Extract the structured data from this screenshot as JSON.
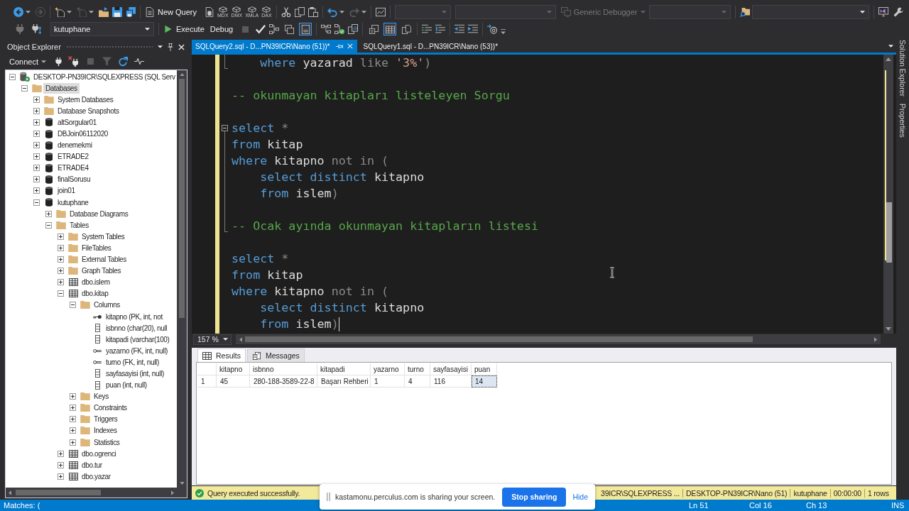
{
  "toolbar": {
    "new_query": "New Query",
    "analysis_queries": [
      "MDX",
      "DMX",
      "XMLA",
      "DAX"
    ],
    "debugger": {
      "label": "Generic Debugger",
      "disabled": true
    },
    "database": "kutuphane",
    "execute": "Execute",
    "debug": "Debug",
    "display_toggles": [
      {
        "on": false
      },
      {
        "on": true
      }
    ],
    "results_toggles": [
      {
        "on": false
      },
      {
        "on": true
      },
      {
        "on": false
      }
    ]
  },
  "object_explorer": {
    "title": "Object Explorer",
    "connect": "Connect",
    "tree": [
      {
        "label": "DESKTOP-PN39ICR\\SQLEXPRESS (SQL Serv",
        "kind": "server",
        "expanded": true,
        "selected": false,
        "children": [
          {
            "label": "Databases",
            "kind": "folder",
            "expanded": true,
            "selected": true,
            "children": [
              {
                "label": "System Databases",
                "kind": "folder",
                "expanded": false,
                "selected": false
              },
              {
                "label": "Database Snapshots",
                "kind": "folder",
                "expanded": false,
                "selected": false
              },
              {
                "label": "altSorgular01",
                "kind": "database",
                "expanded": false,
                "selected": false
              },
              {
                "label": "DBJoin06112020",
                "kind": "database",
                "expanded": false,
                "selected": false
              },
              {
                "label": "denemekmi",
                "kind": "database",
                "expanded": false,
                "selected": false
              },
              {
                "label": "ETRADE2",
                "kind": "database",
                "expanded": false,
                "selected": false
              },
              {
                "label": "ETRADE4",
                "kind": "database",
                "expanded": false,
                "selected": false
              },
              {
                "label": "finalSorusu",
                "kind": "database",
                "expanded": false,
                "selected": false
              },
              {
                "label": "join01",
                "kind": "database",
                "expanded": false,
                "selected": false
              },
              {
                "label": "kutuphane",
                "kind": "database",
                "expanded": true,
                "selected": false,
                "children": [
                  {
                    "label": "Database Diagrams",
                    "kind": "folder",
                    "expanded": false,
                    "selected": false
                  },
                  {
                    "label": "Tables",
                    "kind": "folder",
                    "expanded": true,
                    "selected": false,
                    "children": [
                      {
                        "label": "System Tables",
                        "kind": "folder",
                        "expanded": false,
                        "selected": false
                      },
                      {
                        "label": "FileTables",
                        "kind": "folder",
                        "expanded": false,
                        "selected": false
                      },
                      {
                        "label": "External Tables",
                        "kind": "folder",
                        "expanded": false,
                        "selected": false
                      },
                      {
                        "label": "Graph Tables",
                        "kind": "folder",
                        "expanded": false,
                        "selected": false
                      },
                      {
                        "label": "dbo.islem",
                        "kind": "table",
                        "expanded": false,
                        "selected": false
                      },
                      {
                        "label": "dbo.kitap",
                        "kind": "table",
                        "expanded": true,
                        "selected": false,
                        "children": [
                          {
                            "label": "Columns",
                            "kind": "folder",
                            "expanded": true,
                            "selected": false,
                            "children": [
                              {
                                "label": "kitapno (PK, int, not",
                                "kind": "primary_key",
                                "selected": false
                              },
                              {
                                "label": "isbnno (char(20), null",
                                "kind": "column",
                                "selected": false
                              },
                              {
                                "label": "kitapadi (varchar(100)",
                                "kind": "column",
                                "selected": false
                              },
                              {
                                "label": "yazarno (FK, int, null)",
                                "kind": "foreign_key",
                                "selected": false
                              },
                              {
                                "label": "turno (FK, int, null)",
                                "kind": "foreign_key",
                                "selected": false
                              },
                              {
                                "label": "sayfasayisi (int, null)",
                                "kind": "column",
                                "selected": false
                              },
                              {
                                "label": "puan (int, null)",
                                "kind": "column",
                                "selected": false
                              }
                            ]
                          },
                          {
                            "label": "Keys",
                            "kind": "folder",
                            "expanded": false,
                            "selected": false
                          },
                          {
                            "label": "Constraints",
                            "kind": "folder",
                            "expanded": false,
                            "selected": false
                          },
                          {
                            "label": "Triggers",
                            "kind": "folder",
                            "expanded": false,
                            "selected": false
                          },
                          {
                            "label": "Indexes",
                            "kind": "folder",
                            "expanded": false,
                            "selected": false
                          },
                          {
                            "label": "Statistics",
                            "kind": "folder",
                            "expanded": false,
                            "selected": false
                          }
                        ]
                      },
                      {
                        "label": "dbo.ogrenci",
                        "kind": "table",
                        "expanded": false,
                        "selected": false
                      },
                      {
                        "label": "dbo.tur",
                        "kind": "table",
                        "expanded": false,
                        "selected": false
                      },
                      {
                        "label": "dbo.yazar",
                        "kind": "table",
                        "expanded": false,
                        "selected": false
                      }
                    ]
                  }
                ]
              }
            ]
          }
        ]
      }
    ]
  },
  "editor": {
    "tabs": [
      {
        "label": "SQLQuery2.sql - D...PN39ICR\\Nano (51))*",
        "selected": true
      },
      {
        "label": "SQLQuery1.sql - D...PN39ICR\\Nano (53))*",
        "selected": false
      }
    ],
    "unsaved_changes": true,
    "blocks": [
      [
        {
          "tokens": [
            {
              "text": "    where",
              "kind": "keyword"
            },
            {
              "text": " yazarad",
              "kind": "identifier"
            },
            {
              "text": " like",
              "kind": "operator"
            },
            {
              "text": " '3%'",
              "kind": "string"
            },
            {
              "text": ")",
              "kind": "operator"
            }
          ],
          "fold_end": true
        }
      ],
      [
        {
          "tokens": [
            {
              "text": "-- okunmayan kitapları listeleyen Sorgu",
              "kind": "comment"
            }
          ]
        }
      ],
      [
        {
          "tokens": [
            {
              "text": "select",
              "kind": "keyword"
            },
            {
              "text": " *",
              "kind": "operator"
            }
          ],
          "fold_start": true,
          "expanded": true
        },
        {
          "tokens": [
            {
              "text": "from",
              "kind": "keyword"
            },
            {
              "text": " kitap",
              "kind": "identifier"
            }
          ]
        },
        {
          "tokens": [
            {
              "text": "where",
              "kind": "keyword"
            },
            {
              "text": " kitapno",
              "kind": "identifier"
            },
            {
              "text": " not in (",
              "kind": "operator"
            }
          ]
        },
        {
          "tokens": [
            {
              "text": "    select distinct",
              "kind": "keyword"
            },
            {
              "text": " kitapno",
              "kind": "identifier"
            }
          ]
        },
        {
          "tokens": [
            {
              "text": "    from",
              "kind": "keyword"
            },
            {
              "text": " islem",
              "kind": "identifier"
            },
            {
              "text": ")",
              "kind": "operator"
            }
          ]
        }
      ],
      [
        {
          "tokens": [
            {
              "text": "-- Ocak ayında okunmayan kitapların listesi",
              "kind": "comment"
            }
          ],
          "fold_end": true
        }
      ],
      [
        {
          "tokens": [
            {
              "text": "select",
              "kind": "keyword"
            },
            {
              "text": " *",
              "kind": "operator"
            }
          ]
        },
        {
          "tokens": [
            {
              "text": "from",
              "kind": "keyword"
            },
            {
              "text": " kitap",
              "kind": "identifier"
            }
          ]
        },
        {
          "tokens": [
            {
              "text": "where",
              "kind": "keyword"
            },
            {
              "text": " kitapno",
              "kind": "identifier"
            },
            {
              "text": " not in (",
              "kind": "operator"
            }
          ]
        },
        {
          "tokens": [
            {
              "text": "    select distinct",
              "kind": "keyword"
            },
            {
              "text": " kitapno",
              "kind": "identifier"
            }
          ]
        },
        {
          "tokens": [
            {
              "text": "    from",
              "kind": "keyword"
            },
            {
              "text": " islem",
              "kind": "identifier"
            },
            {
              "text": ")",
              "kind": "operator"
            }
          ],
          "caret": true
        }
      ]
    ],
    "zoom": "157 %"
  },
  "results": {
    "tabs": [
      {
        "label": "Results",
        "kind": "grid",
        "selected": true
      },
      {
        "label": "Messages",
        "kind": "messages",
        "selected": false
      }
    ],
    "columns": [
      "kitapno",
      "isbnno",
      "kitapadi",
      "yazarno",
      "turno",
      "sayfasayisi",
      "puan"
    ],
    "rows": [
      {
        "number": "1",
        "cells": [
          {
            "text": "45",
            "selected": false
          },
          {
            "text": "280-188-3589-22-8",
            "selected": false
          },
          {
            "text": "Başarı Rehberi",
            "selected": false
          },
          {
            "text": "1",
            "selected": false
          },
          {
            "text": "4",
            "selected": false
          },
          {
            "text": "116",
            "selected": false
          },
          {
            "text": "14",
            "selected": true
          }
        ]
      }
    ]
  },
  "status_bar": {
    "succeeded": true,
    "message": "Query executed successfully.",
    "segments": [
      "39ICR\\SQLEXPRESS ...",
      "DESKTOP-PN39ICR\\Nano (51)",
      "kutuphane",
      "00:00:00",
      "1 rows"
    ]
  },
  "side_tabs": [
    "Solution Explorer",
    "Properties"
  ],
  "bottom_bar": {
    "message": "Matches: (",
    "items": [
      "Ln 51",
      "Col 16",
      "Ch 13",
      "INS"
    ]
  },
  "share_notice": {
    "message": "kastamonu.perculus.com is sharing your screen.",
    "stop_button": "Stop sharing",
    "hide_link": "Hide"
  }
}
